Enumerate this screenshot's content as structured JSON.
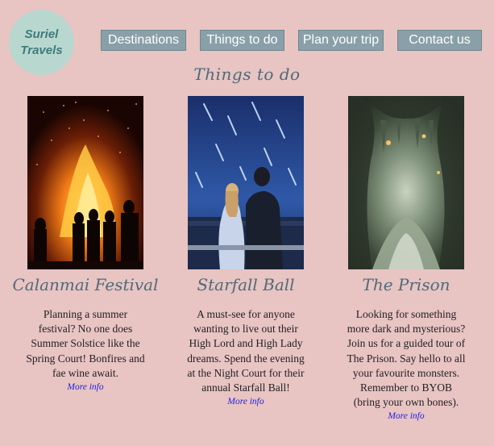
{
  "logo": {
    "line1": "Suriel",
    "line2": "Travels"
  },
  "nav": {
    "destinations": "Destinations",
    "things_to_do": "Things to do",
    "plan_trip": "Plan your trip",
    "contact": "Contact us"
  },
  "page_title": "Things to do",
  "cards": [
    {
      "title": "Calanmai Festival",
      "description": "Planning a summer festival? No one does Summer Solstice like the Spring Court! Bonfires and fae wine await.",
      "link": "More info",
      "image": "bonfire-festival-image"
    },
    {
      "title": "Starfall Ball",
      "description": "A must-see for anyone wanting to live out their High Lord and High Lady dreams. Spend the evening at the Night Court for their annual Starfall Ball!",
      "link": "More info",
      "image": "starfall-couple-image"
    },
    {
      "title": "The Prison",
      "description": "Looking for something more dark and mysterious? Join us for a guided tour of The Prison. Say hello to all your favourite monsters. Remember to BYOB (bring your own bones).",
      "link": "More info",
      "image": "cave-prison-image"
    }
  ],
  "colors": {
    "background": "#e8c4c3",
    "nav_button": "#8aa0a8",
    "heading": "#4e6b78",
    "logo_circle": "#b8d8cf",
    "logo_text": "#3f7a7a",
    "link": "#2222dd"
  }
}
